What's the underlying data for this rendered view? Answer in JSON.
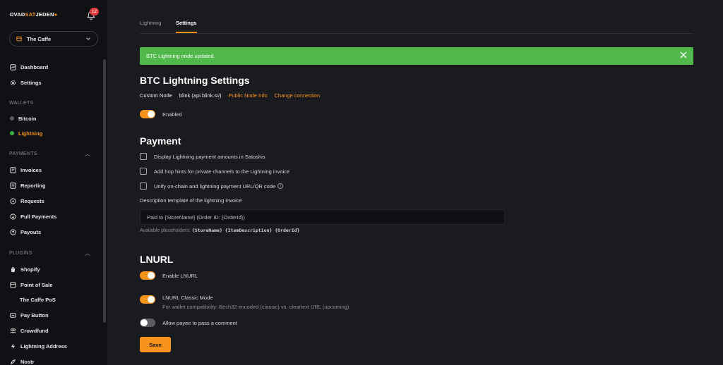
{
  "brand": {
    "logo_part1": "DVAD",
    "logo_part2": "SAT",
    "logo_part3": "JEDEN"
  },
  "notifications": {
    "count": "12"
  },
  "store": {
    "name": "The Caffe"
  },
  "sidebar": {
    "top": [
      {
        "label": "Dashboard"
      },
      {
        "label": "Settings"
      }
    ],
    "wallets_header": "WALLETS",
    "wallets": [
      {
        "label": "Bitcoin"
      },
      {
        "label": "Lightning"
      }
    ],
    "payments_header": "PAYMENTS",
    "payments": [
      {
        "label": "Invoices"
      },
      {
        "label": "Reporting"
      },
      {
        "label": "Requests"
      },
      {
        "label": "Pull Payments"
      },
      {
        "label": "Payouts"
      }
    ],
    "plugins_header": "PLUGINS",
    "plugins": [
      {
        "label": "Shopify"
      },
      {
        "label": "Point of Sale"
      },
      {
        "label": "The Caffe PoS"
      },
      {
        "label": "Pay Button"
      },
      {
        "label": "Crowdfund"
      },
      {
        "label": "Lightning Address"
      },
      {
        "label": "Nostr"
      }
    ]
  },
  "tabs": [
    {
      "label": "Lightning"
    },
    {
      "label": "Settings"
    }
  ],
  "alert": {
    "text": "BTC Lightning node updated."
  },
  "lightning": {
    "title": "BTC Lightning Settings",
    "node_label": "Custom Node",
    "node_value": "blink (api.blink.sv)",
    "public_info": "Public Node Info",
    "change_connection": "Change connection",
    "enabled_label": "Enabled"
  },
  "payment": {
    "title": "Payment",
    "options": [
      {
        "label": "Display Lightning payment amounts in Satoshis"
      },
      {
        "label": "Add hop hints for private channels to the Lightning invoice"
      },
      {
        "label": "Unify on-chain and lightning payment URL/QR code"
      }
    ],
    "desc_label": "Description template of the lightning invoice",
    "desc_value": "Paid to {StoreName} (Order ID: {OrderId})",
    "placeholders_label": "Available placeholders:",
    "placeholders": "{StoreName} {ItemDescription} {OrderId}"
  },
  "lnurl": {
    "title": "LNURL",
    "enable_label": "Enable LNURL",
    "classic_label": "LNURL Classic Mode",
    "classic_help": "For wallet compatibility: Bech32 encoded (classic) vs. cleartext URL (upcoming)",
    "comment_label": "Allow payee to pass a comment"
  },
  "save_label": "Save",
  "colors": {
    "accent": "#f7931a",
    "success": "#51b84b",
    "danger": "#e0393e"
  }
}
